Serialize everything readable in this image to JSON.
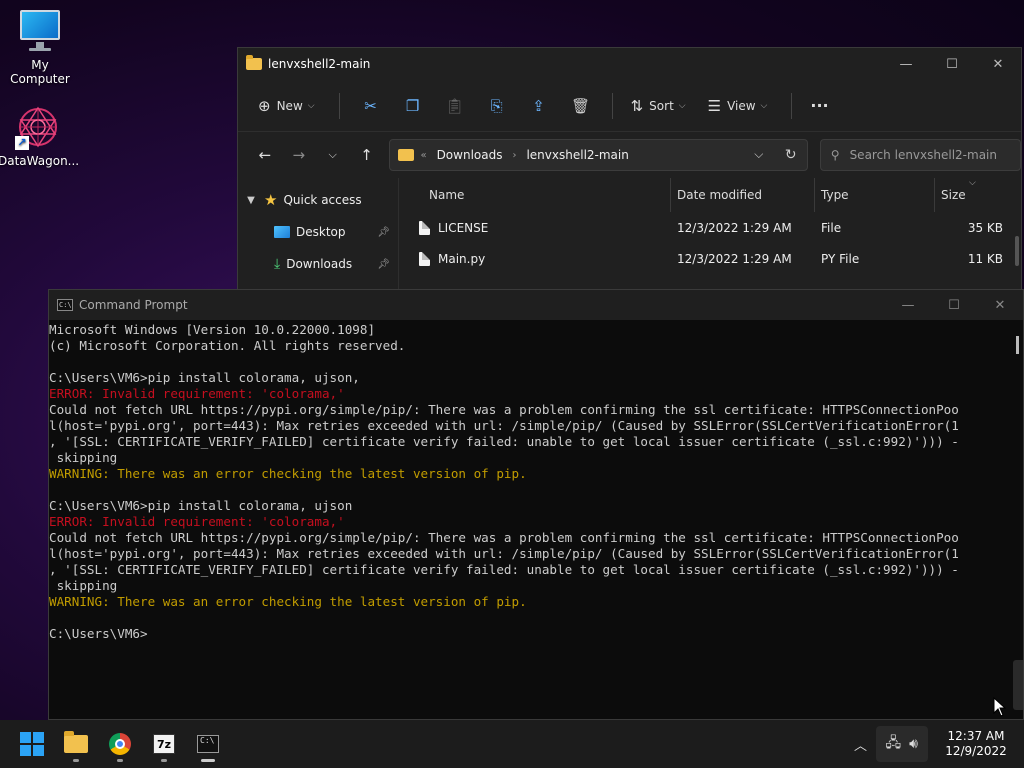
{
  "desktop": {
    "icons": [
      {
        "label": "My Computer",
        "icon": "computer-icon"
      },
      {
        "label": "DataWagon...",
        "icon": "datawagon-icon"
      }
    ]
  },
  "explorer": {
    "title": "lenvxshell2-main",
    "controls": {
      "minimize": "—",
      "maximize": "☐",
      "close": "✕"
    },
    "toolbar": {
      "new_label": "New",
      "sort_label": "Sort",
      "view_label": "View",
      "more_label": "···"
    },
    "address": {
      "parts": [
        "Downloads",
        "lenvxshell2-main"
      ],
      "back_sep": "«"
    },
    "search": {
      "placeholder": "Search lenvxshell2-main"
    },
    "nav_pane": {
      "quick_access": "Quick access",
      "items": [
        {
          "label": "Desktop"
        },
        {
          "label": "Downloads"
        }
      ]
    },
    "columns": {
      "name": "Name",
      "date": "Date modified",
      "type": "Type",
      "size": "Size"
    },
    "files": [
      {
        "name": "LICENSE",
        "date": "12/3/2022 1:29 AM",
        "type": "File",
        "size": "35 KB"
      },
      {
        "name": "Main.py",
        "date": "12/3/2022 1:29 AM",
        "type": "PY File",
        "size": "11 KB"
      }
    ]
  },
  "cmd": {
    "title": "Command Prompt",
    "controls": {
      "minimize": "—",
      "maximize": "☐",
      "close": "✕"
    },
    "lines": [
      {
        "text": "Microsoft Windows [Version 10.0.22000.1098]",
        "kind": "normal"
      },
      {
        "text": "(c) Microsoft Corporation. All rights reserved.",
        "kind": "normal"
      },
      {
        "text": "",
        "kind": "normal"
      },
      {
        "text": "C:\\Users\\VM6>pip install colorama, ujson,",
        "kind": "normal"
      },
      {
        "text": "ERROR: Invalid requirement: 'colorama,'",
        "kind": "err"
      },
      {
        "text": "Could not fetch URL https://pypi.org/simple/pip/: There was a problem confirming the ssl certificate: HTTPSConnectionPoo",
        "kind": "normal"
      },
      {
        "text": "l(host='pypi.org', port=443): Max retries exceeded with url: /simple/pip/ (Caused by SSLError(SSLCertVerificationError(1",
        "kind": "normal"
      },
      {
        "text": ", '[SSL: CERTIFICATE_VERIFY_FAILED] certificate verify failed: unable to get local issuer certificate (_ssl.c:992)'))) -",
        "kind": "normal"
      },
      {
        "text": " skipping",
        "kind": "normal"
      },
      {
        "text": "WARNING: There was an error checking the latest version of pip.",
        "kind": "warn"
      },
      {
        "text": "",
        "kind": "normal"
      },
      {
        "text": "C:\\Users\\VM6>pip install colorama, ujson",
        "kind": "normal"
      },
      {
        "text": "ERROR: Invalid requirement: 'colorama,'",
        "kind": "err"
      },
      {
        "text": "Could not fetch URL https://pypi.org/simple/pip/: There was a problem confirming the ssl certificate: HTTPSConnectionPoo",
        "kind": "normal"
      },
      {
        "text": "l(host='pypi.org', port=443): Max retries exceeded with url: /simple/pip/ (Caused by SSLError(SSLCertVerificationError(1",
        "kind": "normal"
      },
      {
        "text": ", '[SSL: CERTIFICATE_VERIFY_FAILED] certificate verify failed: unable to get local issuer certificate (_ssl.c:992)'))) -",
        "kind": "normal"
      },
      {
        "text": " skipping",
        "kind": "normal"
      },
      {
        "text": "WARNING: There was an error checking the latest version of pip.",
        "kind": "warn"
      },
      {
        "text": "",
        "kind": "normal"
      },
      {
        "text": "C:\\Users\\VM6>",
        "kind": "normal"
      }
    ]
  },
  "taskbar": {
    "apps": [
      "start-icon",
      "file-explorer-icon",
      "chrome-icon",
      "7zip-icon",
      "command-prompt-icon"
    ],
    "sevenzip_label": "7z",
    "time": "12:37 AM",
    "date": "12/9/2022"
  },
  "colors": {
    "error": "#c50f1f",
    "warning": "#c19c00",
    "console_text": "#cccccc",
    "console_bg": "#0c0c0c"
  }
}
